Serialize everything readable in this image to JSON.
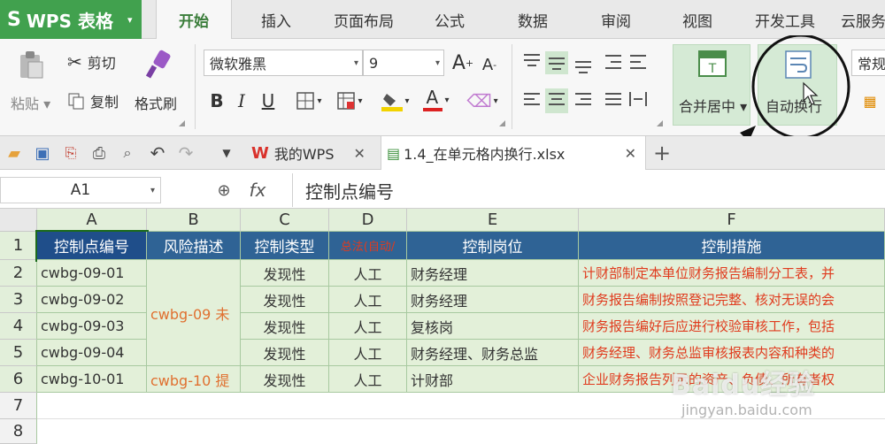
{
  "app": {
    "name": "WPS 表格"
  },
  "menu_tabs": [
    "开始",
    "插入",
    "页面布局",
    "公式",
    "数据",
    "审阅",
    "视图",
    "开发工具",
    "云服务"
  ],
  "ribbon": {
    "paste": "粘贴",
    "cut": "剪切",
    "copy": "复制",
    "format_painter": "格式刷",
    "font_name": "微软雅黑",
    "font_size": "9",
    "merge_center": "合并居中",
    "auto_wrap": "自动换行",
    "number_format": "常规"
  },
  "doc_tabs": [
    {
      "label": "我的WPS"
    },
    {
      "label": "1.4_在单元格内换行.xlsx"
    }
  ],
  "formula_bar": {
    "cell_ref": "A1",
    "fx": "fx",
    "content": "控制点编号"
  },
  "columns": [
    "A",
    "B",
    "C",
    "D",
    "E",
    "F"
  ],
  "rows": [
    "1",
    "2",
    "3",
    "4",
    "5",
    "6",
    "7",
    "8"
  ],
  "header_row": [
    "控制点编号",
    "风险描述",
    "控制类型",
    "总法(自动/",
    "控制岗位",
    "控制措施"
  ],
  "data_rows": [
    {
      "a": "cwbg-09-01",
      "c": "发现性",
      "d": "人工",
      "e": "财务经理",
      "f": "计财部制定本单位财务报告编制分工表，并"
    },
    {
      "a": "cwbg-09-02",
      "c": "发现性",
      "d": "人工",
      "e": "财务经理",
      "f": "财务报告编制按照登记完整、核对无误的会"
    },
    {
      "a": "cwbg-09-03",
      "c": "发现性",
      "d": "人工",
      "e": "复核岗",
      "f": "财务报告编好后应进行校验审核工作，包括"
    },
    {
      "a": "cwbg-09-04",
      "c": "发现性",
      "d": "人工",
      "e": "财务经理、财务总监",
      "f": "财务经理、财务总监审核报表内容和种类的"
    },
    {
      "a": "cwbg-10-01",
      "c": "发现性",
      "d": "人工",
      "e": "计财部",
      "f": "企业财务报告列示的资产、负债、所有者权"
    }
  ],
  "merged_b": {
    "b1": "cwbg-09 未",
    "b2": "cwbg-10 提"
  },
  "watermark": {
    "logo": "Baidu经验",
    "url": "jingyan.baidu.com"
  },
  "colors": {
    "accent_green": "#41a14e",
    "header_blue": "#2f6395",
    "cell_green": "#e3f0d9",
    "text_red": "#e03b1e"
  }
}
